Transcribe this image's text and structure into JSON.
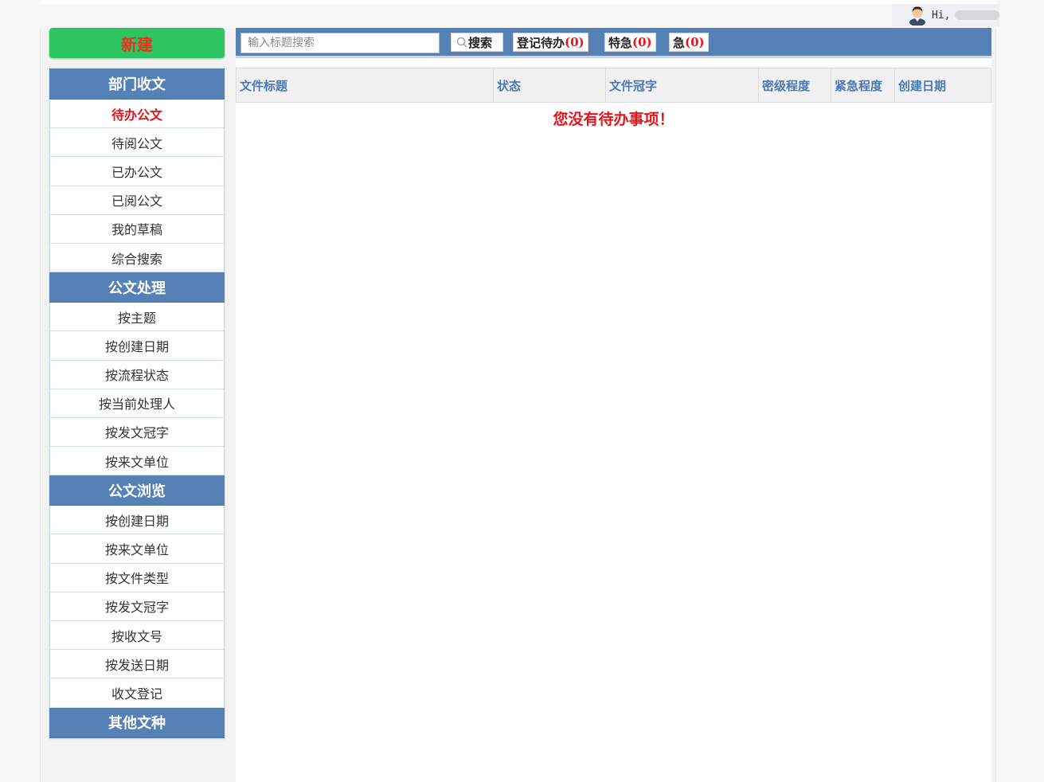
{
  "user": {
    "greeting": "Hi,",
    "name": ""
  },
  "new_button": {
    "label": "新建"
  },
  "sidebar": {
    "sections": [
      {
        "title": "部门收文",
        "items": [
          "待办公文",
          "待阅公文",
          "已办公文",
          "已阅公文",
          "我的草稿",
          "综合搜索"
        ]
      },
      {
        "title": "公文处理",
        "items": [
          "按主题",
          "按创建日期",
          "按流程状态",
          "按当前处理人",
          "按发文冠字",
          "按来文单位"
        ]
      },
      {
        "title": "公文浏览",
        "items": [
          "按创建日期",
          "按来文单位",
          "按文件类型",
          "按发文冠字",
          "按收文号",
          "按发送日期",
          "收文登记"
        ]
      },
      {
        "title": "其他文种",
        "items": []
      }
    ],
    "active_item": "待办公文"
  },
  "toolbar": {
    "search_placeholder": "输入标题搜索",
    "search_label": "搜索",
    "register_pending_label": "登记待办",
    "register_pending_count": "(0)",
    "extra_urgent_label": "特急",
    "extra_urgent_count": "(0)",
    "urgent_label": "急",
    "urgent_count": "(0)"
  },
  "table": {
    "columns": [
      "文件标题",
      "状态",
      "文件冠字",
      "密级程度",
      "紧急程度",
      "创建日期"
    ],
    "empty_message": "您没有待办事项！"
  },
  "colors": {
    "header_blue": "#5581b6",
    "new_button_green": "#2dc55f",
    "alert_red": "#e5141c",
    "column_text_blue": "#4a78b6"
  }
}
